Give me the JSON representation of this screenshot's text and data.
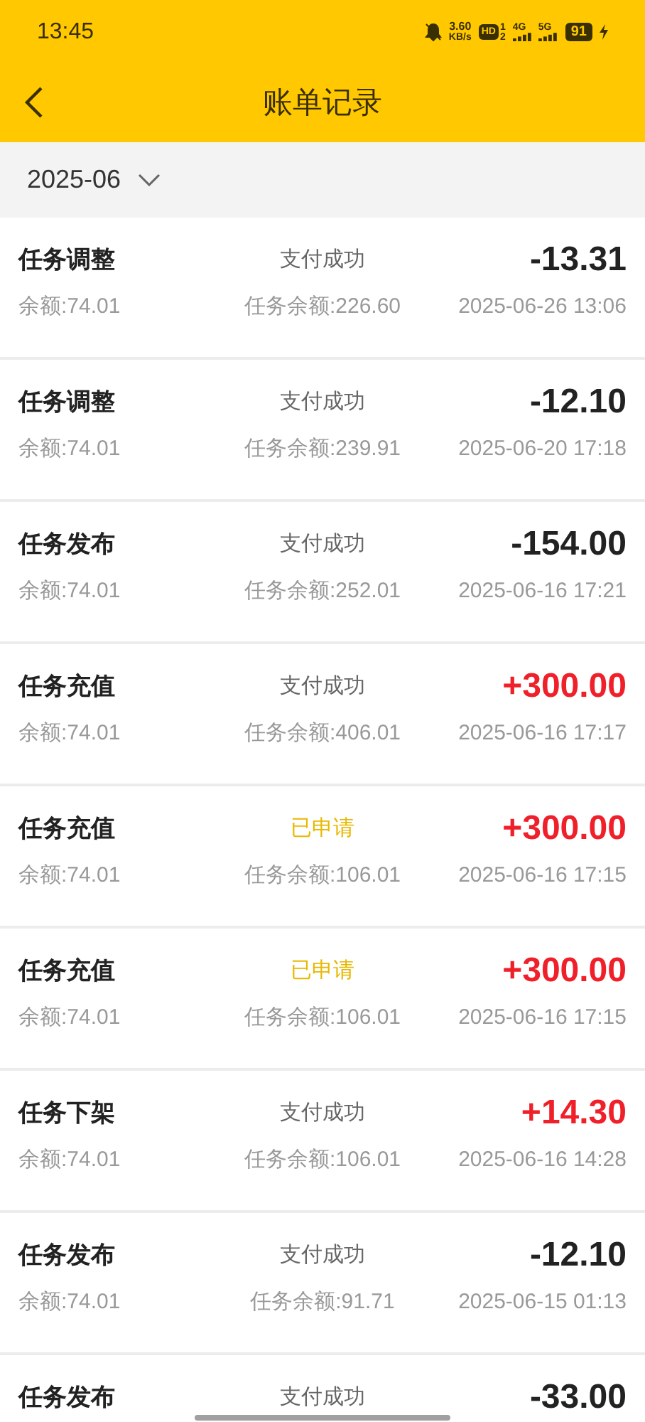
{
  "status_bar": {
    "time": "13:45",
    "speed_value": "3.60",
    "speed_unit": "KB/s",
    "hd": "HD",
    "hd_sims": [
      "1",
      "2"
    ],
    "networks": [
      "4G",
      "5G"
    ],
    "battery": "91"
  },
  "header": {
    "title": "账单记录"
  },
  "month_filter": {
    "value": "2025-06"
  },
  "records": [
    {
      "title": "任务调整",
      "status": {
        "text": "支付成功",
        "kind": "success"
      },
      "amount": {
        "text": "-13.31",
        "kind": "debit"
      },
      "balance": "余额:74.01",
      "task_balance": "任务余额:226.60",
      "time": "2025-06-26 13:06"
    },
    {
      "title": "任务调整",
      "status": {
        "text": "支付成功",
        "kind": "success"
      },
      "amount": {
        "text": "-12.10",
        "kind": "debit"
      },
      "balance": "余额:74.01",
      "task_balance": "任务余额:239.91",
      "time": "2025-06-20 17:18"
    },
    {
      "title": "任务发布",
      "status": {
        "text": "支付成功",
        "kind": "success"
      },
      "amount": {
        "text": "-154.00",
        "kind": "debit"
      },
      "balance": "余额:74.01",
      "task_balance": "任务余额:252.01",
      "time": "2025-06-16 17:21"
    },
    {
      "title": "任务充值",
      "status": {
        "text": "支付成功",
        "kind": "success"
      },
      "amount": {
        "text": "+300.00",
        "kind": "credit"
      },
      "balance": "余额:74.01",
      "task_balance": "任务余额:406.01",
      "time": "2025-06-16 17:17"
    },
    {
      "title": "任务充值",
      "status": {
        "text": "已申请",
        "kind": "applied"
      },
      "amount": {
        "text": "+300.00",
        "kind": "credit"
      },
      "balance": "余额:74.01",
      "task_balance": "任务余额:106.01",
      "time": "2025-06-16 17:15"
    },
    {
      "title": "任务充值",
      "status": {
        "text": "已申请",
        "kind": "applied"
      },
      "amount": {
        "text": "+300.00",
        "kind": "credit"
      },
      "balance": "余额:74.01",
      "task_balance": "任务余额:106.01",
      "time": "2025-06-16 17:15"
    },
    {
      "title": "任务下架",
      "status": {
        "text": "支付成功",
        "kind": "success"
      },
      "amount": {
        "text": "+14.30",
        "kind": "credit"
      },
      "balance": "余额:74.01",
      "task_balance": "任务余额:106.01",
      "time": "2025-06-16 14:28"
    },
    {
      "title": "任务发布",
      "status": {
        "text": "支付成功",
        "kind": "success"
      },
      "amount": {
        "text": "-12.10",
        "kind": "debit"
      },
      "balance": "余额:74.01",
      "task_balance": "任务余额:91.71",
      "time": "2025-06-15 01:13"
    },
    {
      "title": "任务发布",
      "status": {
        "text": "支付成功",
        "kind": "success"
      },
      "amount": {
        "text": "-33.00",
        "kind": "debit"
      }
    }
  ]
}
